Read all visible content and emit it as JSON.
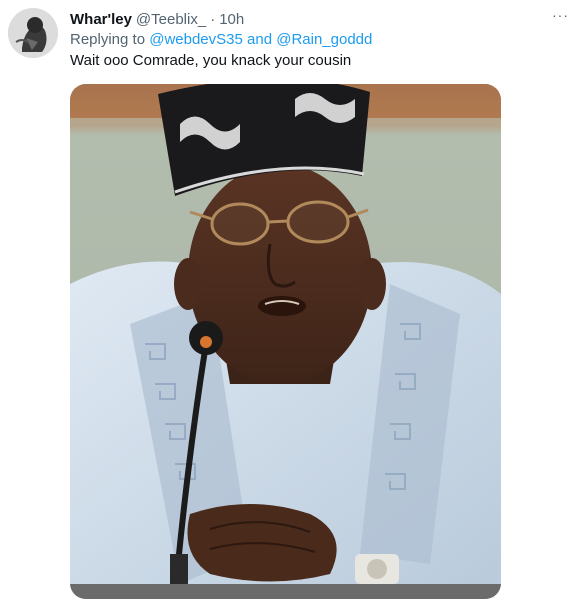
{
  "tweet": {
    "display_name": "Whar'ley",
    "handle": "@Teeblix_",
    "separator": "·",
    "time": "10h",
    "more_glyph": "···",
    "replying": {
      "prefix": "Replying to",
      "mention1": "@webdevS35",
      "conjunction": "and",
      "mention2": "@Rain_goddd"
    },
    "text": "Wait ooo Comrade, you knack your cousin"
  },
  "icons": {
    "more": "more-options-icon",
    "avatar": "profile-avatar"
  },
  "colors": {
    "primary_text": "#0f1419",
    "secondary_text": "#536471",
    "link": "#1d9bf0"
  }
}
